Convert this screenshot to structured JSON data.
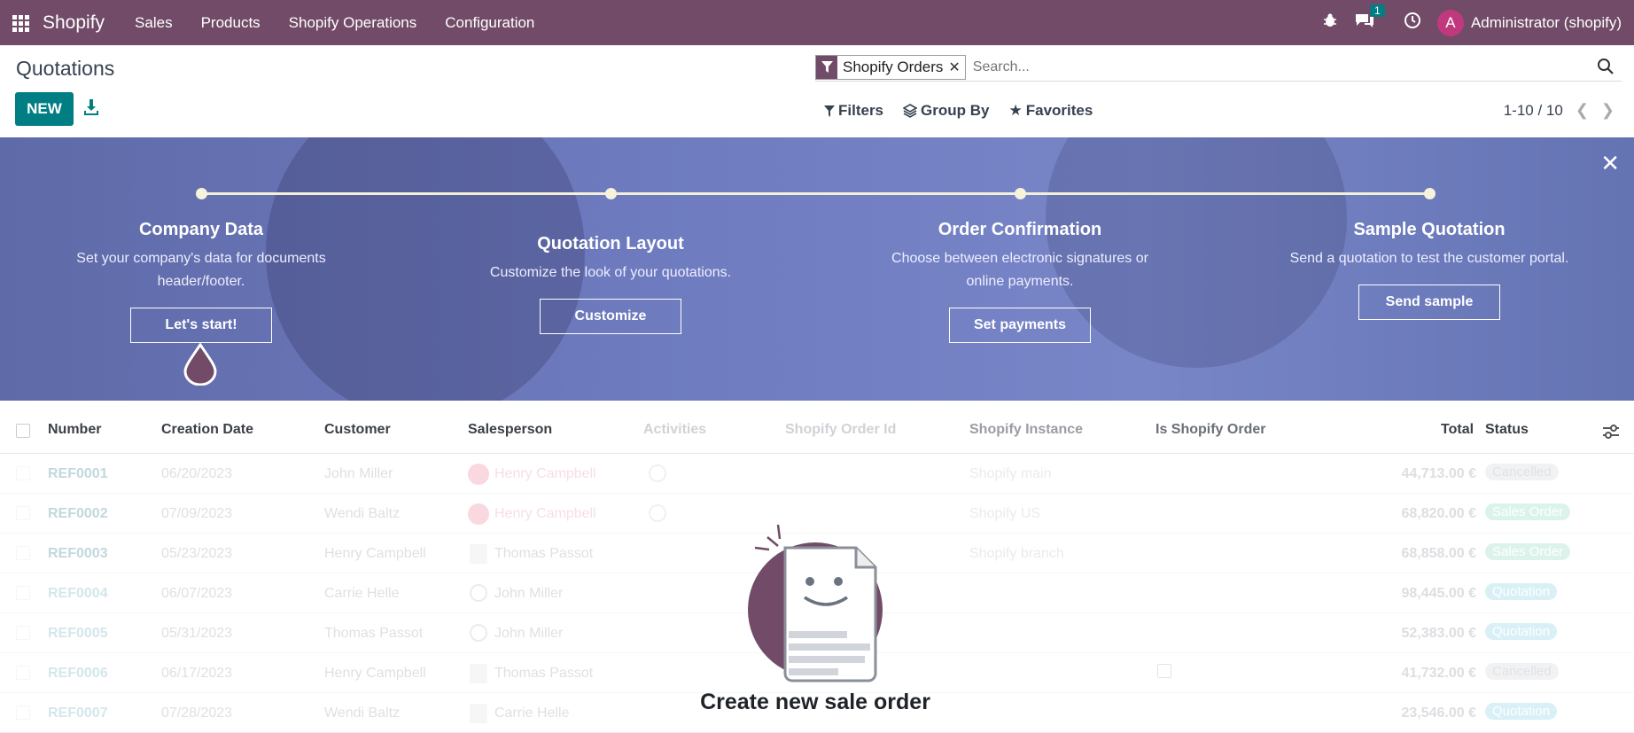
{
  "nav": {
    "brand": "Shopify",
    "menus": [
      "Sales",
      "Products",
      "Shopify Operations",
      "Configuration"
    ],
    "message_count": "1",
    "avatar_letter": "A",
    "user_name": "Administrator (shopify)"
  },
  "control": {
    "title": "Quotations",
    "new_label": "NEW",
    "facet_label": "Shopify Orders",
    "search_placeholder": "Search...",
    "filters_label": "Filters",
    "groupby_label": "Group By",
    "favorites_label": "Favorites",
    "pager": "1-10 / 10"
  },
  "banner": {
    "steps": [
      {
        "title": "Company Data",
        "desc": "Set your company's data for documents header/footer.",
        "button": "Let's start!"
      },
      {
        "title": "Quotation Layout",
        "desc": "Customize the look of your quotations.",
        "button": "Customize"
      },
      {
        "title": "Order Confirmation",
        "desc": "Choose between electronic signatures or online payments.",
        "button": "Set payments"
      },
      {
        "title": "Sample Quotation",
        "desc": "Send a quotation to test the customer portal.",
        "button": "Send sample"
      }
    ]
  },
  "list": {
    "columns": {
      "number": "Number",
      "creation_date": "Creation Date",
      "customer": "Customer",
      "salesperson": "Salesperson",
      "activities": "Activities",
      "shopify_order_id": "Shopify Order Id",
      "shopify_instance": "Shopify Instance",
      "is_shopify_order": "Is Shopify Order",
      "total": "Total",
      "status": "Status"
    },
    "rows": [
      {
        "number": "REF0001",
        "date": "06/20/2023",
        "customer": "John Miller",
        "salesperson": "Henry Campbell",
        "instance": "Shopify main",
        "total": "44,713.00 €",
        "status": "Cancelled"
      },
      {
        "number": "REF0002",
        "date": "07/09/2023",
        "customer": "Wendi Baltz",
        "salesperson": "Henry Campbell",
        "instance": "Shopify US",
        "total": "68,820.00 €",
        "status": "Sales Order"
      },
      {
        "number": "REF0003",
        "date": "05/23/2023",
        "customer": "Henry Campbell",
        "salesperson": "Thomas Passot",
        "instance": "Shopify branch",
        "total": "68,858.00 €",
        "status": "Sales Order"
      },
      {
        "number": "REF0004",
        "date": "06/07/2023",
        "customer": "Carrie Helle",
        "salesperson": "John Miller",
        "instance": "",
        "total": "98,445.00 €",
        "status": "Quotation"
      },
      {
        "number": "REF0005",
        "date": "05/31/2023",
        "customer": "Thomas Passot",
        "salesperson": "John Miller",
        "instance": "",
        "total": "52,383.00 €",
        "status": "Quotation"
      },
      {
        "number": "REF0006",
        "date": "06/17/2023",
        "customer": "Henry Campbell",
        "salesperson": "Thomas Passot",
        "instance": "",
        "total": "41,732.00 €",
        "status": "Cancelled"
      },
      {
        "number": "REF0007",
        "date": "07/28/2023",
        "customer": "Wendi Baltz",
        "salesperson": "Carrie Helle",
        "instance": "",
        "total": "23,546.00 €",
        "status": "Quotation"
      }
    ]
  },
  "empty_state": {
    "title": "Create new sale order"
  },
  "colors": {
    "brand": "#714b67",
    "primary": "#017e84"
  }
}
